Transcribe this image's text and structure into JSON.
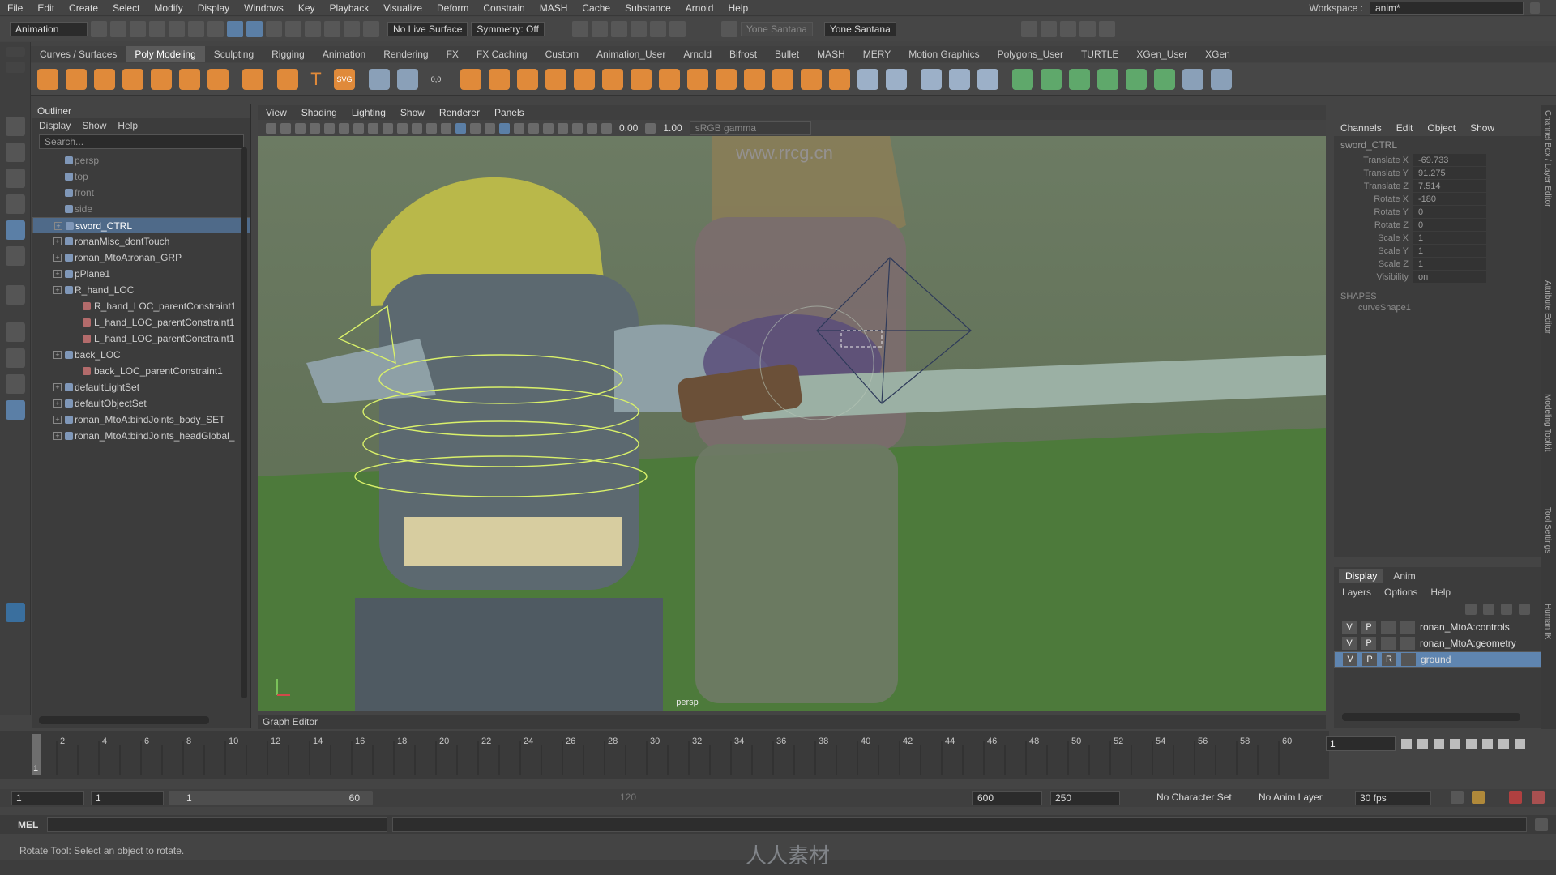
{
  "menubar": {
    "items": [
      "File",
      "Edit",
      "Create",
      "Select",
      "Modify",
      "Display",
      "Windows",
      "Key",
      "Playback",
      "Visualize",
      "Deform",
      "Constrain",
      "MASH",
      "Cache",
      "Substance",
      "Arnold",
      "Help"
    ],
    "workspace_label": "Workspace :",
    "workspace_value": "anim*"
  },
  "statusline": {
    "menu_set": "Animation",
    "live_surface": "No Live Surface",
    "symmetry": "Symmetry: Off",
    "user": "Yone Santana",
    "user2": "Yone Santana"
  },
  "shelf": {
    "tabs": [
      "Curves / Surfaces",
      "Poly Modeling",
      "Sculpting",
      "Rigging",
      "Animation",
      "Rendering",
      "FX",
      "FX Caching",
      "Custom",
      "Animation_User",
      "Arnold",
      "Bifrost",
      "Bullet",
      "MASH",
      "MERY",
      "Motion Graphics",
      "Polygons_User",
      "TURTLE",
      "XGen_User",
      "XGen"
    ],
    "active_tab": "Poly Modeling",
    "icon_text": "T",
    "svg_label": "SVG",
    "coord_label": "0,0"
  },
  "outliner": {
    "title": "Outliner",
    "menu": [
      "Display",
      "Show",
      "Help"
    ],
    "search_placeholder": "Search...",
    "rows": [
      {
        "label": "persp",
        "dim": true
      },
      {
        "label": "top",
        "dim": true
      },
      {
        "label": "front",
        "dim": true
      },
      {
        "label": "side",
        "dim": true
      },
      {
        "label": "sword_CTRL",
        "selected": true
      },
      {
        "label": "ronanMisc_dontTouch"
      },
      {
        "label": "ronan_MtoA:ronan_GRP"
      },
      {
        "label": "pPlane1"
      },
      {
        "label": "R_hand_LOC"
      },
      {
        "label": "R_hand_LOC_parentConstraint1",
        "sub": true
      },
      {
        "label": "L_hand_LOC_parentConstraint1",
        "sub": true
      },
      {
        "label": "L_hand_LOC_parentConstraint1",
        "sub": true
      },
      {
        "label": "back_LOC"
      },
      {
        "label": "back_LOC_parentConstraint1",
        "sub": true
      },
      {
        "label": "defaultLightSet"
      },
      {
        "label": "defaultObjectSet"
      },
      {
        "label": "ronan_MtoA:bindJoints_body_SET"
      },
      {
        "label": "ronan_MtoA:bindJoints_headGlobal_"
      }
    ]
  },
  "viewport": {
    "menu": [
      "View",
      "Shading",
      "Lighting",
      "Show",
      "Renderer",
      "Panels"
    ],
    "exposure": "0.00",
    "gamma": "1.00",
    "colorspace": "sRGB gamma",
    "camera": "persp",
    "watermark": "www.rrcg.cn"
  },
  "graph_editor_label": "Graph Editor",
  "channelbox": {
    "menu": [
      "Channels",
      "Edit",
      "Object",
      "Show"
    ],
    "object": "sword_CTRL",
    "channels": [
      {
        "name": "Translate X",
        "value": "-69.733"
      },
      {
        "name": "Translate Y",
        "value": "91.275"
      },
      {
        "name": "Translate Z",
        "value": "7.514"
      },
      {
        "name": "Rotate X",
        "value": "-180"
      },
      {
        "name": "Rotate Y",
        "value": "0"
      },
      {
        "name": "Rotate Z",
        "value": "0"
      },
      {
        "name": "Scale X",
        "value": "1"
      },
      {
        "name": "Scale Y",
        "value": "1"
      },
      {
        "name": "Scale Z",
        "value": "1"
      },
      {
        "name": "Visibility",
        "value": "on"
      }
    ],
    "shapes_label": "SHAPES",
    "shape": "curveShape1"
  },
  "layers": {
    "tabs": [
      "Display",
      "Anim"
    ],
    "menu": [
      "Layers",
      "Options",
      "Help"
    ],
    "rows": [
      {
        "v": "V",
        "p": "P",
        "r": "",
        "name": "ronan_MtoA:controls"
      },
      {
        "v": "V",
        "p": "P",
        "r": "",
        "name": "ronan_MtoA:geometry"
      },
      {
        "v": "V",
        "p": "P",
        "r": "R",
        "name": "ground",
        "selected": true
      }
    ]
  },
  "side_tabs": [
    "Channel Box / Layer Editor",
    "Attribute Editor",
    "Modeling Toolkit",
    "Tool Settings",
    "Human IK"
  ],
  "timeline": {
    "ticks": [
      "2",
      "4",
      "6",
      "8",
      "10",
      "12",
      "14",
      "16",
      "18",
      "20",
      "22",
      "24",
      "26",
      "28",
      "30",
      "32",
      "34",
      "36",
      "38",
      "40",
      "42",
      "44",
      "46",
      "48",
      "50",
      "52",
      "54",
      "56",
      "58",
      "60"
    ],
    "current_frame": "1",
    "current_field": "1"
  },
  "range": {
    "start": "1",
    "inner_start": "1",
    "slider_start": "1",
    "slider_end": "60",
    "mid_value": "120",
    "end": "600",
    "anim_end": "250",
    "character_set": "No Character Set",
    "anim_layer": "No Anim Layer",
    "fps": "30 fps"
  },
  "mel": {
    "label": "MEL"
  },
  "helpline": "Rotate Tool: Select an object to rotate.",
  "watermark_center": "人人素材",
  "colors": {
    "accent": "#5b7fa6",
    "viewport_bg": "#5b6d4f",
    "ground": "#4d7a3b"
  }
}
